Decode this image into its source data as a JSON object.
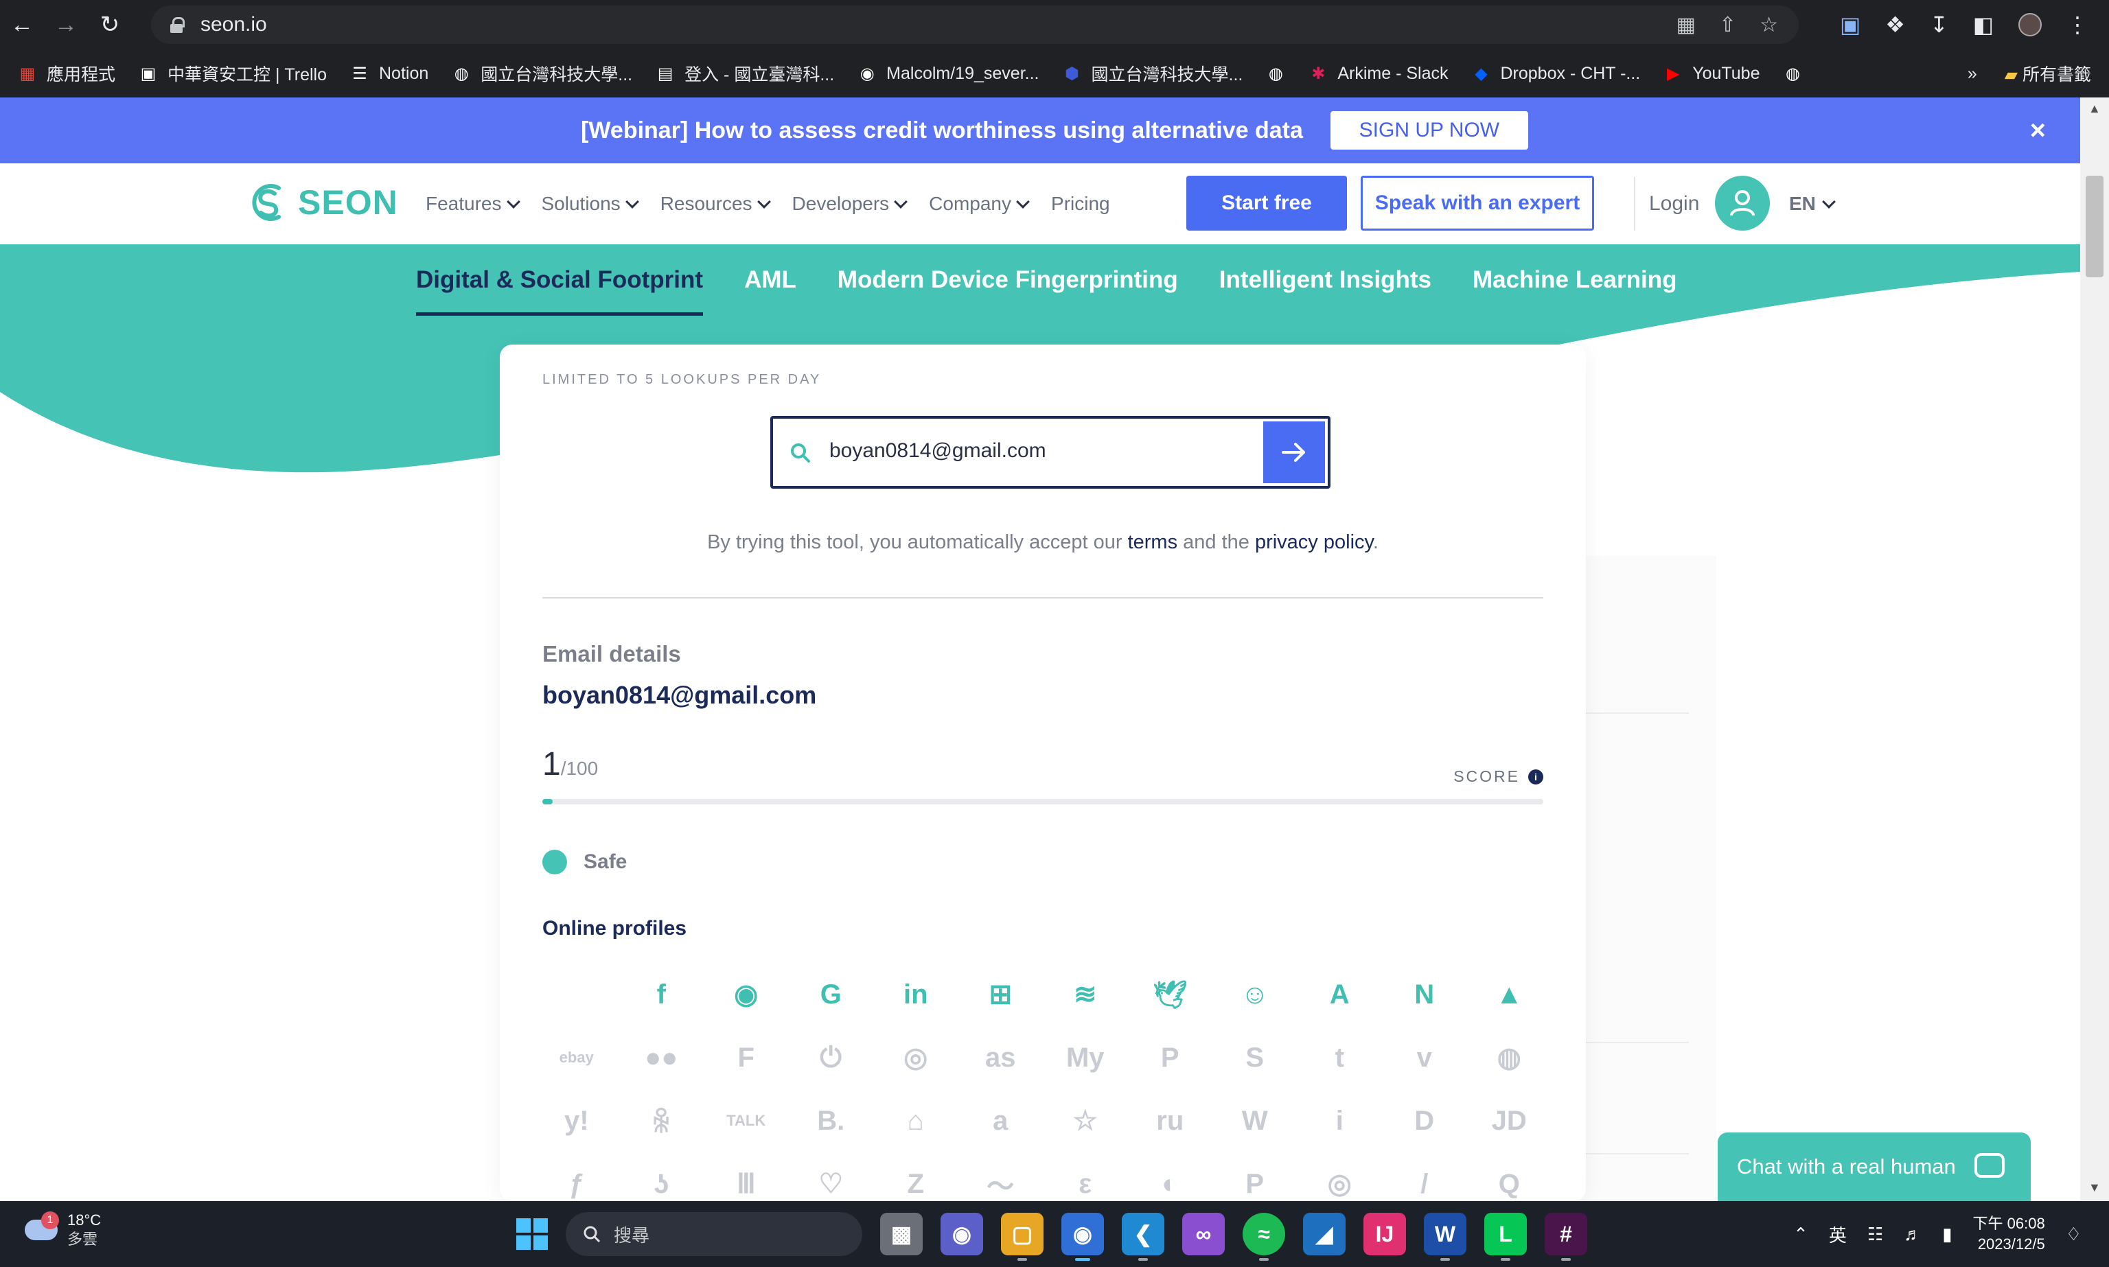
{
  "browser": {
    "url": "seon.io",
    "bookmarks": [
      {
        "label": "應用程式",
        "icon": "apps-grid-icon",
        "color": "#ea4335"
      },
      {
        "label": "中華資安工控 | Trello",
        "icon": "trello-icon",
        "color": "#ffffff"
      },
      {
        "label": "Notion",
        "icon": "notion-list-icon",
        "color": "#ffffff"
      },
      {
        "label": "國立台灣科技大學...",
        "icon": "globe-icon",
        "color": "#ffffff"
      },
      {
        "label": "登入 - 國立臺灣科...",
        "icon": "document-icon",
        "color": "#ffffff"
      },
      {
        "label": "Malcolm/19_sever...",
        "icon": "github-icon",
        "color": "#ffffff"
      },
      {
        "label": "國立台灣科技大學...",
        "icon": "shield-badge-icon",
        "color": "#3b5bdb"
      },
      {
        "label": "",
        "icon": "globe-icon",
        "color": "#ffffff"
      },
      {
        "label": "Arkime - Slack",
        "icon": "slack-icon",
        "color": "#e01e5a"
      },
      {
        "label": "Dropbox - CHT -...",
        "icon": "dropbox-icon",
        "color": "#0061ff"
      },
      {
        "label": "YouTube",
        "icon": "youtube-icon",
        "color": "#ff0000"
      },
      {
        "label": "",
        "icon": "globe-icon",
        "color": "#ffffff"
      }
    ],
    "more_bookmarks": "»",
    "all_bookmarks": "所有書籤"
  },
  "banner": {
    "text": "[Webinar] How to assess credit worthiness using alternative data",
    "button": "SIGN UP NOW",
    "close": "×"
  },
  "header": {
    "logo_text": "SEON",
    "nav": [
      {
        "label": "Features",
        "has_dropdown": true
      },
      {
        "label": "Solutions",
        "has_dropdown": true
      },
      {
        "label": "Resources",
        "has_dropdown": true
      },
      {
        "label": "Developers",
        "has_dropdown": true
      },
      {
        "label": "Company",
        "has_dropdown": true
      },
      {
        "label": "Pricing",
        "has_dropdown": false
      }
    ],
    "start_free": "Start free",
    "speak_expert": "Speak with an expert",
    "login": "Login",
    "lang": "EN"
  },
  "tabs": [
    {
      "label": "Digital & Social Footprint",
      "active": true
    },
    {
      "label": "AML",
      "active": false
    },
    {
      "label": "Modern Device Fingerprinting",
      "active": false
    },
    {
      "label": "Intelligent Insights",
      "active": false
    },
    {
      "label": "Machine Learning",
      "active": false
    }
  ],
  "tool": {
    "limit_text": "LIMITED TO 5 LOOKUPS PER DAY",
    "search_value": "boyan0814@gmail.com",
    "disclaimer_pre": "By trying this tool, you automatically accept our ",
    "terms": "terms",
    "disclaimer_mid": " and the ",
    "privacy": "privacy policy",
    "disclaimer_end": ".",
    "email_details_label": "Email details",
    "email": "boyan0814@gmail.com",
    "score": "1",
    "score_max": "/100",
    "score_label": "SCORE",
    "score_fraction": 0.01,
    "status": "Safe",
    "online_profiles_label": "Online profiles",
    "profiles": [
      {
        "icon": "apple-icon",
        "glyph": "",
        "found": true
      },
      {
        "icon": "facebook-icon",
        "glyph": "f",
        "found": true
      },
      {
        "icon": "github-icon",
        "glyph": "◉",
        "found": true
      },
      {
        "icon": "google-icon",
        "glyph": "G",
        "found": true
      },
      {
        "icon": "linkedin-icon",
        "glyph": "in",
        "found": true
      },
      {
        "icon": "windows-icon",
        "glyph": "⊞",
        "found": true
      },
      {
        "icon": "spotify-icon",
        "glyph": "≋",
        "found": true
      },
      {
        "icon": "twitter-icon",
        "glyph": "🕊",
        "found": true
      },
      {
        "icon": "discord-icon",
        "glyph": "☺",
        "found": true
      },
      {
        "icon": "adobe-icon",
        "glyph": "A",
        "found": true
      },
      {
        "icon": "notion-icon",
        "glyph": "N",
        "found": true
      },
      {
        "icon": "atlassian-icon",
        "glyph": "▲",
        "found": true
      },
      {
        "icon": "ebay-icon",
        "glyph": "ebay",
        "found": false
      },
      {
        "icon": "flickr-icon",
        "glyph": "●●",
        "found": false
      },
      {
        "icon": "foursquare-icon",
        "glyph": "F",
        "found": false
      },
      {
        "icon": "power-icon",
        "glyph": "⏻",
        "found": false
      },
      {
        "icon": "instagram-icon",
        "glyph": "◎",
        "found": false
      },
      {
        "icon": "lastfm-icon",
        "glyph": "as",
        "found": false
      },
      {
        "icon": "myspace-icon",
        "glyph": "My",
        "found": false
      },
      {
        "icon": "pinterest-icon",
        "glyph": "P",
        "found": false
      },
      {
        "icon": "skype-icon",
        "glyph": "S",
        "found": false
      },
      {
        "icon": "tumblr-icon",
        "glyph": "t",
        "found": false
      },
      {
        "icon": "vimeo-icon",
        "glyph": "v",
        "found": false
      },
      {
        "icon": "weibo-icon",
        "glyph": "◍",
        "found": false
      },
      {
        "icon": "yahoo-icon",
        "glyph": "y!",
        "found": false
      },
      {
        "icon": "odnoklassniki-icon",
        "glyph": "ꆜ",
        "found": false
      },
      {
        "icon": "kakao-talk-icon",
        "glyph": "TALK",
        "found": false
      },
      {
        "icon": "booking-icon",
        "glyph": "B.",
        "found": false
      },
      {
        "icon": "airbnb-icon",
        "glyph": "⌂",
        "found": false
      },
      {
        "icon": "amazon-icon",
        "glyph": "a",
        "found": false
      },
      {
        "icon": "star-icon",
        "glyph": "☆",
        "found": false
      },
      {
        "icon": "rambler-icon",
        "glyph": "ru",
        "found": false
      },
      {
        "icon": "wordpress-icon",
        "glyph": "W",
        "found": false
      },
      {
        "icon": "info-icon",
        "glyph": "i",
        "found": false
      },
      {
        "icon": "disney-icon",
        "glyph": "D",
        "found": false
      },
      {
        "icon": "jd-icon",
        "glyph": "JD",
        "found": false
      },
      {
        "icon": "freelancer-icon",
        "glyph": "ƒ",
        "found": false
      },
      {
        "icon": "venmo-icon",
        "glyph": "ʖ",
        "found": false
      },
      {
        "icon": "archive-icon",
        "glyph": "Ⅲ",
        "found": false
      },
      {
        "icon": "heart-icon",
        "glyph": "♡",
        "found": false
      },
      {
        "icon": "zoho-icon",
        "glyph": "Z",
        "found": false
      },
      {
        "icon": "swoosh-icon",
        "glyph": "〜",
        "found": false
      },
      {
        "icon": "evernote-icon",
        "glyph": "ε",
        "found": false
      },
      {
        "icon": "leaf-icon",
        "glyph": "◐",
        "found": false
      },
      {
        "icon": "patreon-icon",
        "glyph": "P",
        "found": false
      },
      {
        "icon": "tripadvisor-icon",
        "glyph": "◎",
        "found": false
      },
      {
        "icon": "slash-icon",
        "glyph": "/",
        "found": false
      },
      {
        "icon": "quora-icon",
        "glyph": "Q",
        "found": false
      }
    ]
  },
  "chat": {
    "label": "Chat with a real human"
  },
  "taskbar": {
    "weather_badge": "1",
    "temperature": "18°C",
    "weather": "多雲",
    "search": "搜尋",
    "ime": "英",
    "time": "下午 06:08",
    "date": "2023/12/5"
  },
  "colors": {
    "teal": "#45c3b4",
    "navy": "#1c2a5a",
    "blue": "#4a6cf2",
    "banner": "#5b73f5"
  }
}
